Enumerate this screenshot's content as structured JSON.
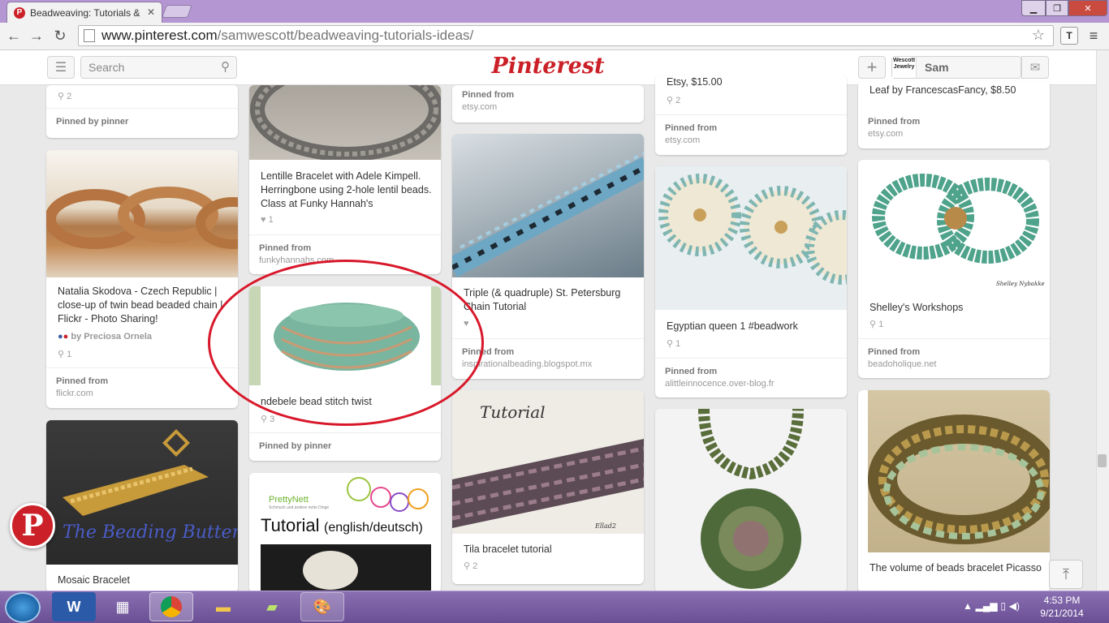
{
  "browser": {
    "tab_title": "Beadweaving: Tutorials &",
    "url_domain": "www.pinterest.com",
    "url_path": "/samwescott/beadweaving-tutorials-ideas/"
  },
  "header": {
    "search_placeholder": "Search",
    "logo": "Pinterest",
    "avatar_text": "Wescott Jewelry",
    "user_name": "Sam"
  },
  "pins": {
    "c1_top": {
      "count": "2",
      "pinned_label": "Pinned by pinner"
    },
    "c1_natalia": {
      "title": "Natalia Skodova - Czech Republic | close-up of twin bead beaded chain | Flickr - Photo Sharing!",
      "via": "by Preciosa Ornela",
      "count": "1",
      "pinned_label": "Pinned from",
      "source": "flickr.com"
    },
    "c1_mosaic": {
      "title": "Mosaic Bracelet",
      "image_text": "The Beading Butterfly"
    },
    "c2_lentille": {
      "title": "Lentille Bracelet with Adele Kimpell. Herringbone using 2-hole lentil beads. Class at Funky Hannah's",
      "count": "1",
      "pinned_label": "Pinned from",
      "source": "funkyhannahs.com"
    },
    "c2_ndebele": {
      "title": "ndebele bead stitch twist",
      "count": "3",
      "pinned_label": "Pinned by pinner"
    },
    "c2_prettynett": {
      "brand": "PrettyNett",
      "tagline": "Schmuck und andere nette Dinge",
      "tutorial": "Tutorial",
      "lang": "(english/deutsch)"
    },
    "c3_top": {
      "pinned_label": "Pinned from",
      "source": "etsy.com"
    },
    "c3_triple": {
      "title": "Triple (& quadruple) St. Petersburg Chain Tutorial",
      "pinned_label": "Pinned from",
      "source": "inspirationalbeading.blogspot.mx"
    },
    "c3_tila": {
      "image_text": "Tutorial",
      "signature": "Ellad2",
      "title": "Tila bracelet tutorial",
      "count": "2"
    },
    "c4_top": {
      "price": "Etsy, $15.00",
      "count": "2",
      "pinned_label": "Pinned from",
      "source": "etsy.com"
    },
    "c4_egypt": {
      "title": "Egyptian queen 1 #beadwork",
      "count": "1",
      "pinned_label": "Pinned from",
      "source": "alittleinnocence.over-blog.fr"
    },
    "c5_top": {
      "title": "Leaf by FrancescasFancy, $8.50",
      "pinned_label": "Pinned from",
      "source": "etsy.com"
    },
    "c5_shelley": {
      "signature": "Shelley Nybakke",
      "title": "Shelley's Workshops",
      "count": "1",
      "pinned_label": "Pinned from",
      "source": "beadoholique.net"
    },
    "c5_volume": {
      "title": "The volume of beads bracelet Picasso"
    }
  },
  "taskbar": {
    "time": "4:53 PM",
    "date": "9/21/2014"
  },
  "colors": {
    "brand": "#cb2027",
    "annotation_circle": "#d8182a",
    "taskbar": "#7a5fa6"
  }
}
